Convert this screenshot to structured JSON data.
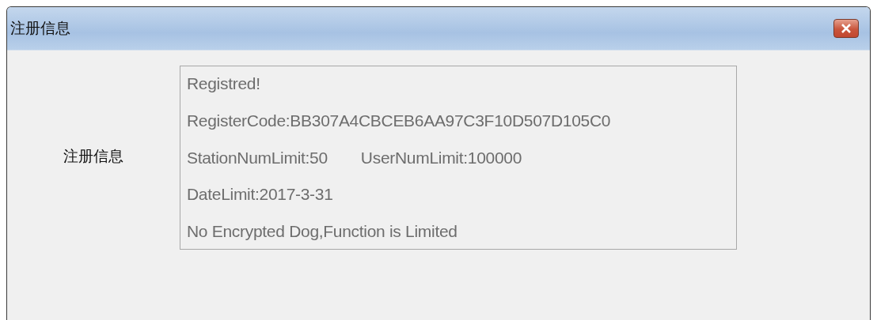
{
  "window": {
    "title": "注册信息"
  },
  "label": "注册信息",
  "info_lines": [
    {
      "items": [
        "Registred!"
      ]
    },
    {
      "items": [
        "RegisterCode:BB307A4CBCEB6AA97C3F10D507D105C0"
      ]
    },
    {
      "items": [
        "StationNumLimit:50",
        "UserNumLimit:100000"
      ]
    },
    {
      "items": [
        "DateLimit:2017-3-31"
      ]
    },
    {
      "items": [
        "No Encrypted Dog,Function is Limited"
      ]
    }
  ]
}
